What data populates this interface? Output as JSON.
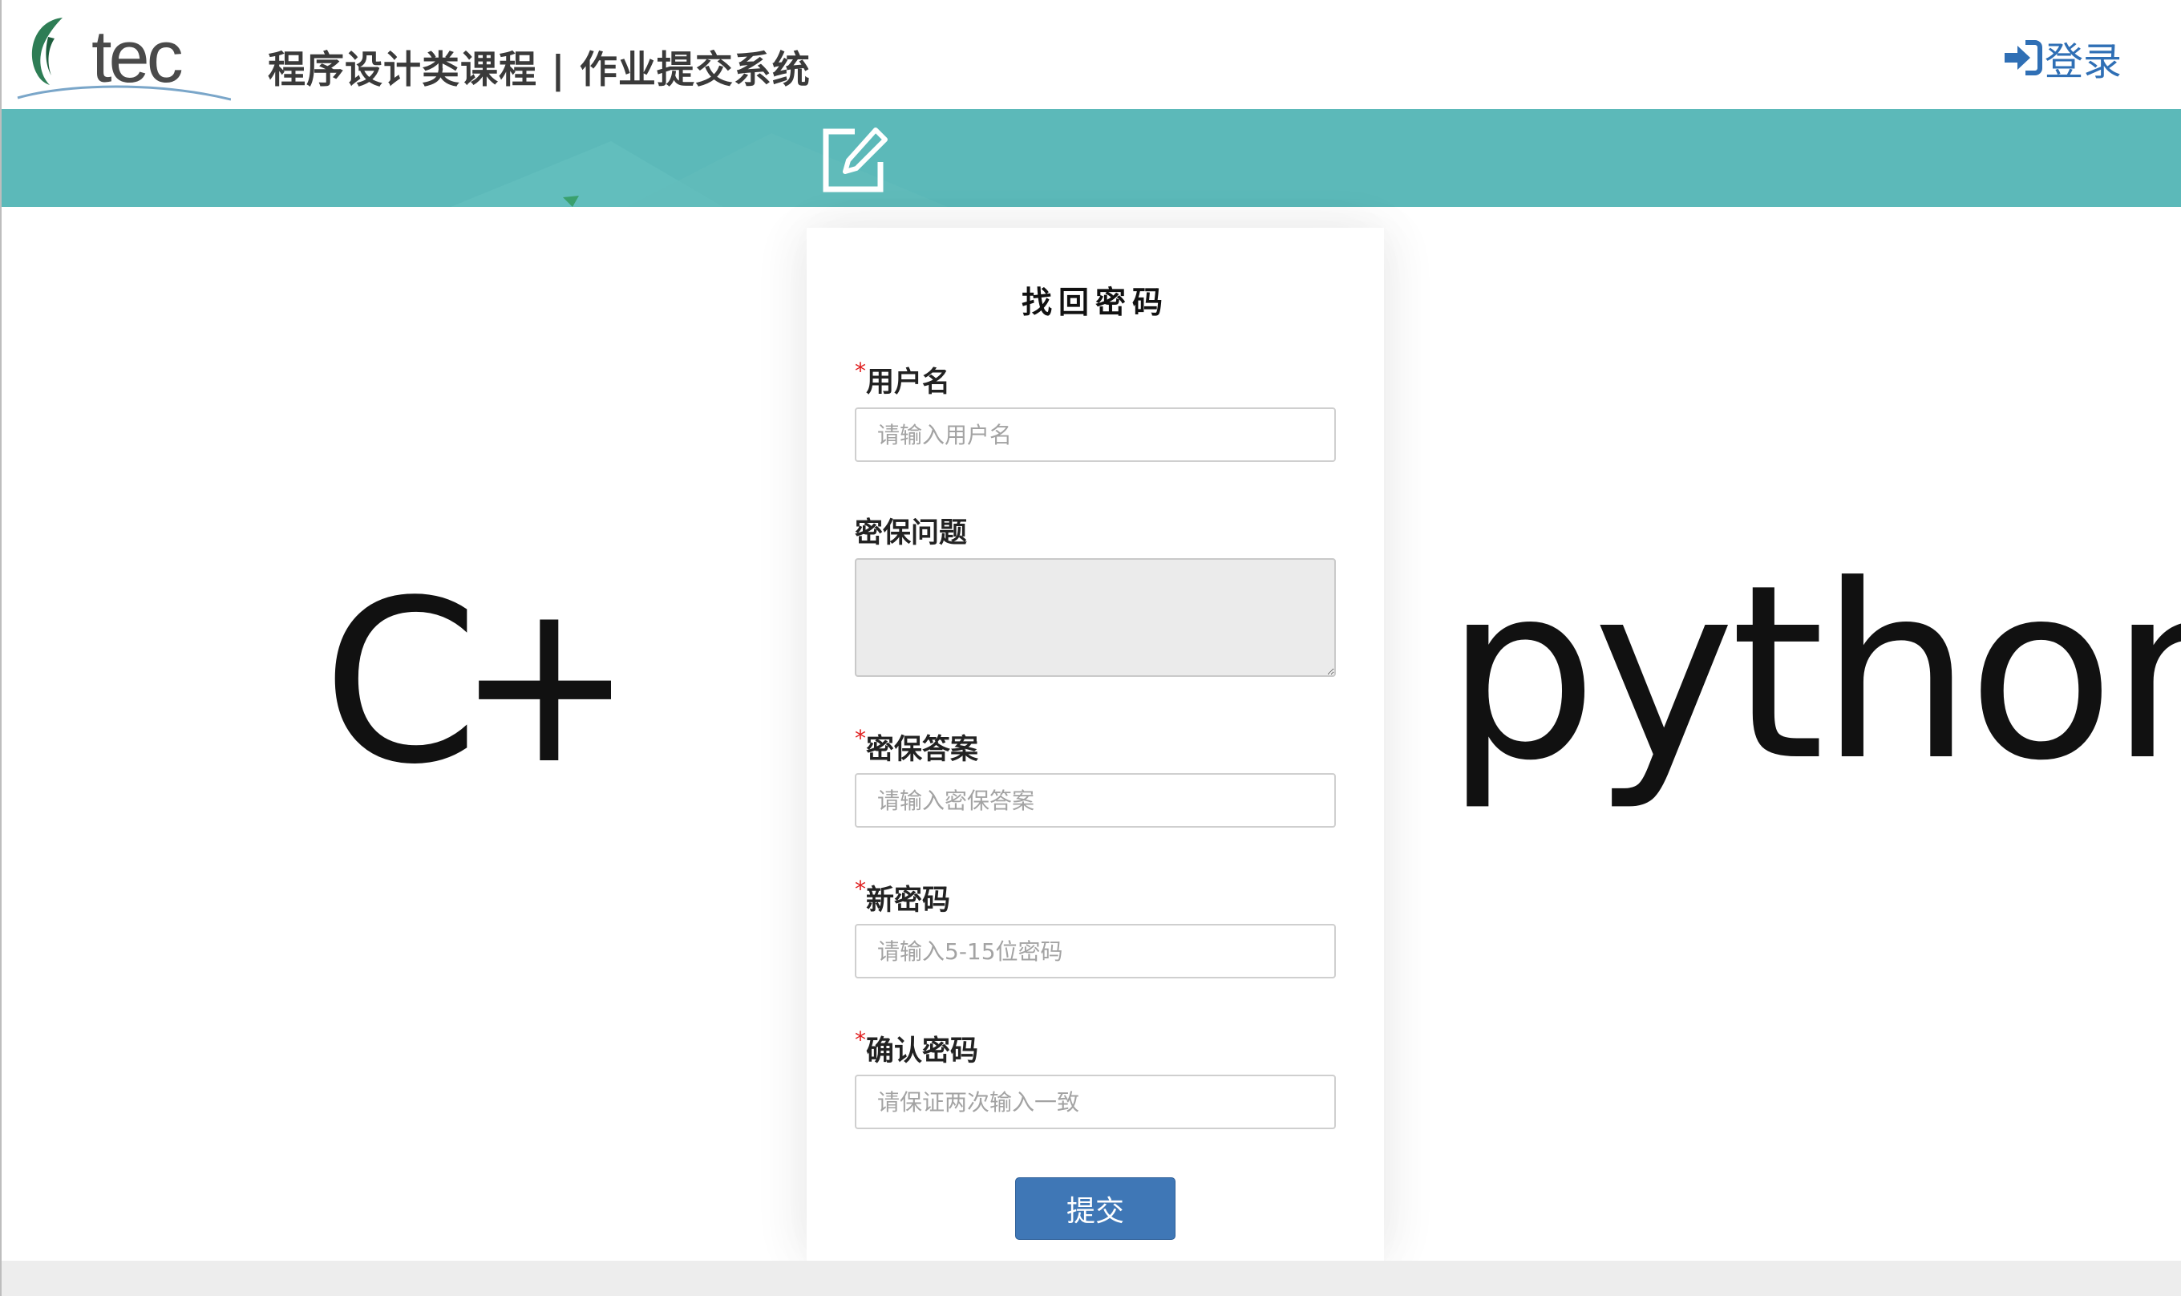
{
  "header": {
    "logo_text": "tec",
    "site_title": "程序设计类课程 | 作业提交系统",
    "login_label": "登录",
    "login_icon": "sign-in-icon"
  },
  "banner": {
    "icon": "edit-icon",
    "color": "#5cb9b9"
  },
  "side_logos": {
    "cpp": "C++",
    "python": "python"
  },
  "form": {
    "title": "找回密码",
    "required_mark": "*",
    "fields": {
      "username": {
        "label": "用户名",
        "placeholder": "请输入用户名",
        "value": ""
      },
      "question": {
        "label": "密保问题",
        "value": ""
      },
      "answer": {
        "label": "密保答案",
        "placeholder": "请输入密保答案",
        "value": ""
      },
      "new_password": {
        "label": "新密码",
        "placeholder": "请输入5-15位密码",
        "value": ""
      },
      "confirm_password": {
        "label": "确认密码",
        "placeholder": "请保证两次输入一致",
        "value": ""
      }
    },
    "submit_label": "提交"
  },
  "colors": {
    "accent": "#3f77b6",
    "link": "#2f6fb5",
    "required": "#e02020"
  }
}
